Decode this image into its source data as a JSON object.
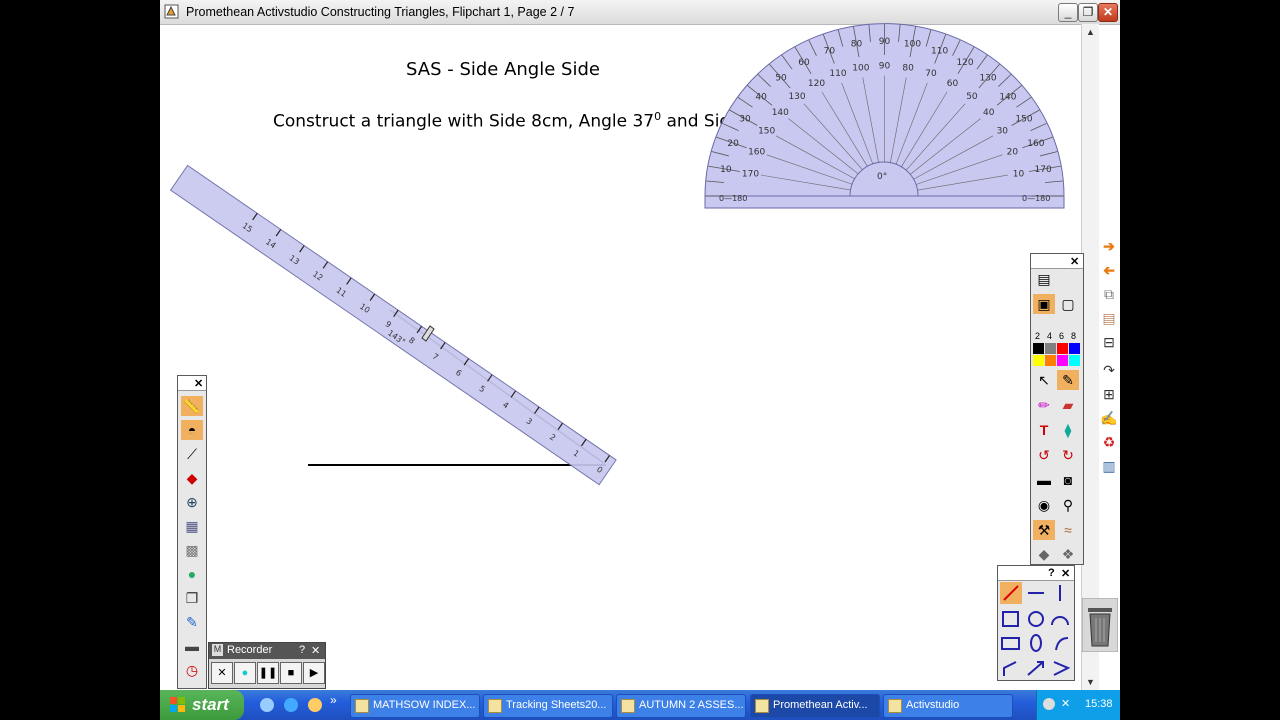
{
  "window": {
    "title": "Promethean Activstudio   Constructing Triangles,  Flipchart 1,  Page 2 / 7",
    "minimize": "_",
    "restore": "❐",
    "close": "✕"
  },
  "canvas": {
    "heading": "SAS - Side Angle Side",
    "instruction_main": "Construct a triangle with Side 8cm, Angle 37",
    "instruction_sup": "0",
    "instruction_tail": " and Side 6cm"
  },
  "ruler": {
    "ticks": [
      "15",
      "14",
      "13",
      "12",
      "11",
      "10",
      "9",
      "8",
      "7",
      "6",
      "5",
      "4",
      "3",
      "2",
      "1",
      "0"
    ],
    "angle_readout": "143°"
  },
  "protractor": {
    "outer_labels": [
      "10",
      "20",
      "30",
      "40",
      "50",
      "60",
      "70",
      "80",
      "90",
      "100",
      "110",
      "120",
      "130",
      "140",
      "150",
      "160",
      "170"
    ],
    "inner_labels": [
      "170",
      "160",
      "150",
      "140",
      "130",
      "120",
      "110",
      "100",
      "90",
      "80",
      "70",
      "60",
      "50",
      "40",
      "30",
      "20",
      "10"
    ],
    "base_left": "0—180",
    "base_right": "0—180",
    "center": "0°"
  },
  "right_toolbox": {
    "pen_widths": [
      "2",
      "4",
      "6",
      "8"
    ],
    "colors": [
      "#000000",
      "#808080",
      "#ff0000",
      "#00ff00",
      "#0000ff",
      "#ffff00",
      "#ff8000",
      "#ff00ff",
      "#00ffff",
      "#c0c0c0"
    ]
  },
  "shape_toolbox": {
    "help": "?",
    "close": "✕"
  },
  "recorder": {
    "icon": "M",
    "title": "Recorder",
    "help": "?",
    "close": "✕",
    "buttons": [
      "✕",
      "●",
      "❚❚",
      "■",
      "▶"
    ]
  },
  "taskbar": {
    "start": "start",
    "chevron": "»",
    "tasks": [
      "MATHSOW INDEX...",
      "Tracking Sheets20...",
      "AUTUMN 2 ASSES...",
      "Promethean Activ...",
      "Activstudio"
    ],
    "clock": "15:38"
  },
  "colors": {
    "tool_transparent": "#c8c8f0",
    "tool_stroke": "#6a6aa6",
    "taskbar": "#245edc"
  }
}
